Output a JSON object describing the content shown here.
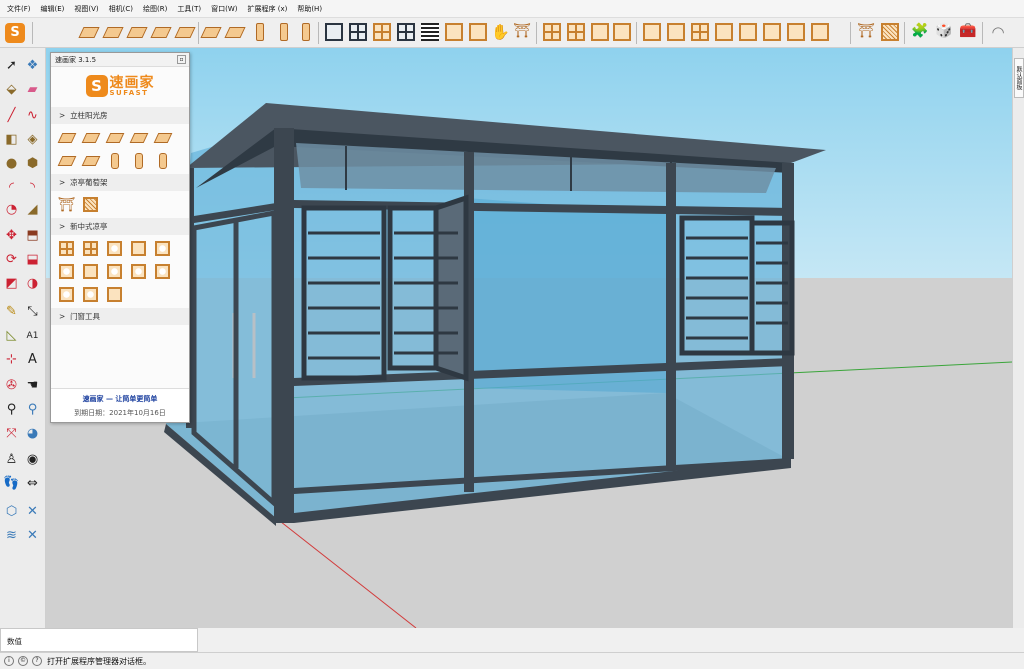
{
  "menu": {
    "items": [
      "文件(F)",
      "编辑(E)",
      "视图(V)",
      "相机(C)",
      "绘图(R)",
      "工具(T)",
      "窗口(W)",
      "扩展程序 (x)",
      "帮助(H)"
    ]
  },
  "toolbar": {
    "icons": [
      "sufast-logo-icon",
      "plate-icon",
      "plate-icon",
      "plate-icon",
      "plate-icon",
      "plate-icon",
      "plate-icon",
      "plate-icon",
      "column-icon",
      "column-icon",
      "column-icon",
      "frame-icon",
      "frame-grid-icon",
      "frame-grid-icon",
      "lines-icon",
      "frame-icon",
      "frame-icon",
      "hand-icon",
      "gate-icon",
      "frame-grid-icon",
      "frame-grid-icon",
      "frame-icon",
      "frame-icon",
      "frame-icon",
      "frame-icon",
      "lines-icon",
      "frame-icon",
      "frame-icon",
      "frame-icon",
      "frame-icon",
      "frame-icon",
      "pavilion-icon",
      "lattice-icon",
      "extension-icon",
      "extension-icon",
      "extension-icon",
      "curve-icon"
    ]
  },
  "plugin": {
    "title": "速画家 3.1.5",
    "logo_cn": "速画家",
    "logo_en": "SUFAST",
    "sections": [
      {
        "label": "立柱阳光房"
      },
      {
        "label": "凉亭葡萄架"
      },
      {
        "label": "新中式凉亭"
      },
      {
        "label": "门窗工具"
      }
    ],
    "slogan": "速画家 — 让简单更简单",
    "expire": "到期日期：2021年10月16日"
  },
  "right_tray": {
    "tab_label": "默认面板"
  },
  "measurements": {
    "label": "数值"
  },
  "status": {
    "text": "打开扩展程序管理器对话框。"
  },
  "colors": {
    "sky_top": "#8fd2ee",
    "ground": "#d0d0d0",
    "frame": "#3c4650",
    "glass": "#5aaed6",
    "brand": "#ee8a1c"
  }
}
